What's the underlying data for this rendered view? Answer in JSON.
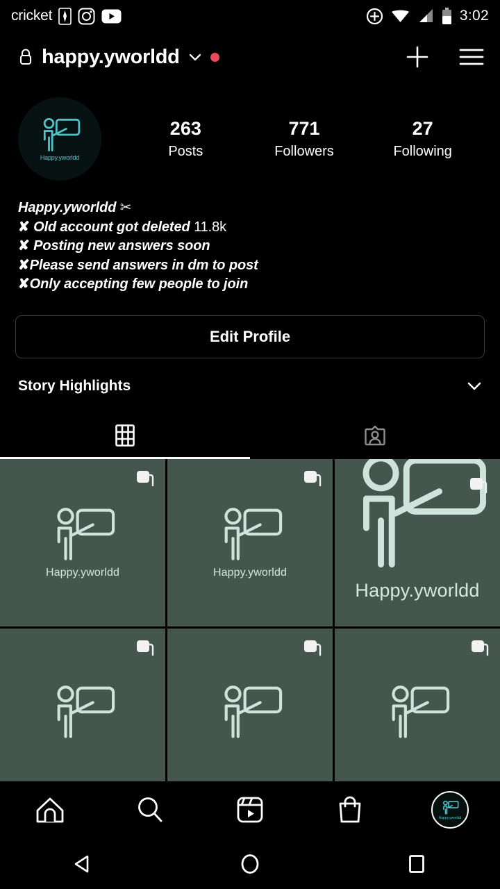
{
  "status_bar": {
    "carrier": "cricket",
    "clock": "3:02",
    "left_icons": [
      "nba-icon",
      "instagram-icon",
      "youtube-icon"
    ],
    "right_icons": [
      "data-saver-icon",
      "wifi-icon",
      "cellular-signal-icon",
      "battery-icon"
    ]
  },
  "header": {
    "username": "happy.yworldd",
    "lock_icon": "lock-icon",
    "chevron_icon": "chevron-down-icon",
    "notification_dot": true,
    "add_label": "+",
    "menu_icon": "hamburger-menu-icon",
    "add_icon": "plus-icon"
  },
  "profile": {
    "avatar_label": "Happy.yworldd",
    "stats": [
      {
        "num": "263",
        "label": "Posts"
      },
      {
        "num": "771",
        "label": "Followers"
      },
      {
        "num": "27",
        "label": "Following"
      }
    ],
    "bio": [
      {
        "text": "Happy.yworldd ",
        "mark": "",
        "suffix": "✂",
        "suffix_plain": true
      },
      {
        "mark": "✘",
        "text": " Old account got deleted ",
        "suffix": "11.8k",
        "suffix_plain": true
      },
      {
        "mark": "✘",
        "text": " Posting new answers soon",
        "suffix": "",
        "suffix_plain": false
      },
      {
        "mark": "✘",
        "text": "Please send answers in dm to post",
        "suffix": "",
        "suffix_plain": false
      },
      {
        "mark": "✘",
        "text": "Only accepting few people to join",
        "suffix": "",
        "suffix_plain": false
      }
    ],
    "edit_profile_label": "Edit Profile",
    "highlights_title": "Story Highlights",
    "highlights_chevron": "chevron-down-icon"
  },
  "tabs": [
    {
      "name": "grid-tab",
      "icon": "grid-icon",
      "active": true
    },
    {
      "name": "tagged-tab",
      "icon": "tagged-person-icon",
      "active": false
    }
  ],
  "posts": [
    {
      "label": "Happy.yworldd",
      "carousel": true,
      "zoomed": false
    },
    {
      "label": "Happy.yworldd",
      "carousel": true,
      "zoomed": false
    },
    {
      "label": "Happy.yworldd",
      "carousel": true,
      "zoomed": true
    },
    {
      "label": "",
      "carousel": true,
      "zoomed": false
    },
    {
      "label": "",
      "carousel": true,
      "zoomed": false
    },
    {
      "label": "",
      "carousel": true,
      "zoomed": false
    }
  ],
  "bottom_nav": [
    {
      "name": "nav-home",
      "icon": "home-icon"
    },
    {
      "name": "nav-search",
      "icon": "search-icon"
    },
    {
      "name": "nav-reels",
      "icon": "reels-icon"
    },
    {
      "name": "nav-shop",
      "icon": "shopping-bag-icon"
    },
    {
      "name": "nav-profile",
      "icon": "profile-avatar-icon",
      "label": "Happy.yworldd"
    }
  ],
  "system_nav": [
    {
      "name": "back-button",
      "icon": "triangle-back-icon"
    },
    {
      "name": "home-button",
      "icon": "circle-home-icon"
    },
    {
      "name": "recents-button",
      "icon": "square-recents-icon"
    }
  ],
  "colors": {
    "background": "#000000",
    "thumb_bg": "#44564E",
    "thumb_icon": "#cfe3dd",
    "accent_teal": "#4fc3c9",
    "notification_red": "#ED4956"
  }
}
